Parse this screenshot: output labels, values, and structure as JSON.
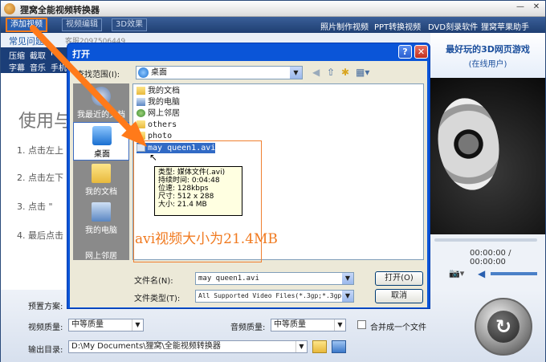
{
  "window": {
    "title": "狸窝全能视频转换器",
    "minimize": "—",
    "close": "✕"
  },
  "toolbar": {
    "add_video": "添加视频",
    "video_edit": "视频编辑",
    "effect_3d": "3D效果",
    "links": [
      "照片制作视频",
      "PPT转换视频",
      "DVD刻录软件",
      "狸窝苹果助手"
    ]
  },
  "tabs": {
    "faq": "常见问题",
    "qq": "客服2097506449"
  },
  "subnav": {
    "compress": "压缩",
    "cut": "截取",
    "f": "F",
    "subtitle": "字幕",
    "music": "音乐",
    "phone": "手机"
  },
  "ad": {
    "line1": "最好玩的3D网页游戏",
    "line2": "(在线用户)"
  },
  "main": {
    "title": "使用与",
    "steps": [
      "1. 点击左上",
      "2. 点击左下",
      "3. 点击 \"",
      "4. 最后点击"
    ]
  },
  "player": {
    "time": "00:00:00 / 00:00:00"
  },
  "bottom": {
    "preset_label": "预置方案:",
    "video_quality_label": "视频质量:",
    "video_quality_value": "中等质量",
    "audio_quality_label": "音频质量:",
    "audio_quality_value": "中等质量",
    "merge_label": "合并成一个文件",
    "output_label": "输出目录:",
    "output_value": "D:\\My Documents\\狸窝\\全能视频转换器"
  },
  "dialog": {
    "title": "打开",
    "help": "?",
    "close": "✕",
    "lookin_label": "查找范围(I):",
    "lookin_value": "桌面",
    "places": [
      "我最近的文档",
      "桌面",
      "我的文档",
      "我的电脑",
      "网上邻居"
    ],
    "files": [
      {
        "name": "我的文档",
        "icon": "documents-icon"
      },
      {
        "name": "我的电脑",
        "icon": "computer-icon"
      },
      {
        "name": "网上邻居",
        "icon": "network-icon"
      },
      {
        "name": "others",
        "icon": "folder-icon"
      },
      {
        "name": "photo",
        "icon": "folder-icon"
      },
      {
        "name": "may queen1.avi",
        "icon": "video-file-icon"
      }
    ],
    "tooltip": [
      "类型: 媒体文件(.avi)",
      "持续时间: 0:04:48",
      "位速: 128kbps",
      "尺寸: 512 x 288",
      "大小: 21.4 MB"
    ],
    "annotation": "avi视频大小为21.4MB",
    "filename_label": "文件名(N):",
    "filename_value": "may queen1.avi",
    "filetype_label": "文件类型(T):",
    "filetype_value": "All Supported Video Files(*.3gp;*.3gp",
    "open_button": "打开(O)",
    "cancel_button": "取消"
  },
  "colors": {
    "accent": "#ff7a1a",
    "dialog_blue": "#0a55d8",
    "selection": "#316ac5"
  }
}
